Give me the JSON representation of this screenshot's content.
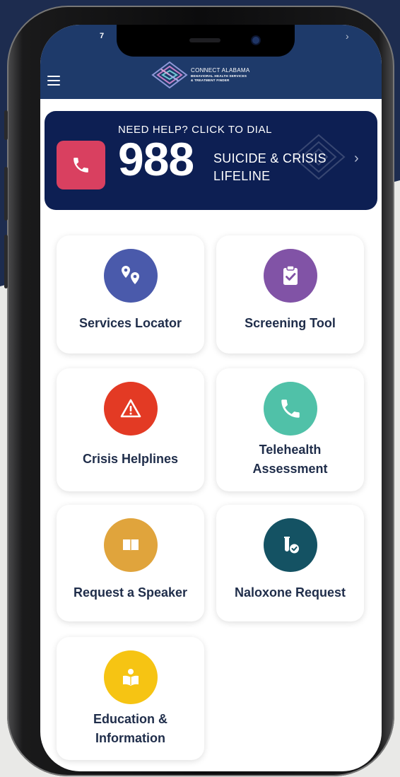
{
  "status": {
    "time": "7"
  },
  "header": {
    "logo_title": "CONNECT ALABAMA",
    "logo_sub1": "BEHAVIORAL HEALTH SERVICES",
    "logo_sub2": "& TREATMENT FINDER"
  },
  "banner": {
    "need_help": "NEED HELP? CLICK TO DIAL",
    "number": "988",
    "line1": "SUICIDE & CRISIS",
    "line2": "LIFELINE"
  },
  "tiles": [
    {
      "line1": "Services Locator",
      "line2": "",
      "icon": "map-pins-icon",
      "color": "#4a5aab"
    },
    {
      "line1": "Screening Tool",
      "line2": "",
      "icon": "clipboard-check-icon",
      "color": "#8153a6"
    },
    {
      "line1": "Crisis Helplines",
      "line2": "",
      "icon": "warning-icon",
      "color": "#e33a24"
    },
    {
      "line1": "Telehealth",
      "line2": "Assessment",
      "icon": "phone-icon",
      "color": "#50c1a8"
    },
    {
      "line1": "Request a Speaker",
      "line2": "",
      "icon": "book-icon",
      "color": "#e0a43c"
    },
    {
      "line1": "Naloxone Request",
      "line2": "",
      "icon": "test-tube-check-icon",
      "color": "#145263"
    },
    {
      "line1": "Education &",
      "line2": "Information",
      "icon": "reading-person-icon",
      "color": "#f6c413"
    }
  ],
  "colors": {
    "appbar": "#1e3a6a",
    "banner": "#0d1f53",
    "banner_phone": "#d94060",
    "tile_text": "#1f2d4a"
  }
}
